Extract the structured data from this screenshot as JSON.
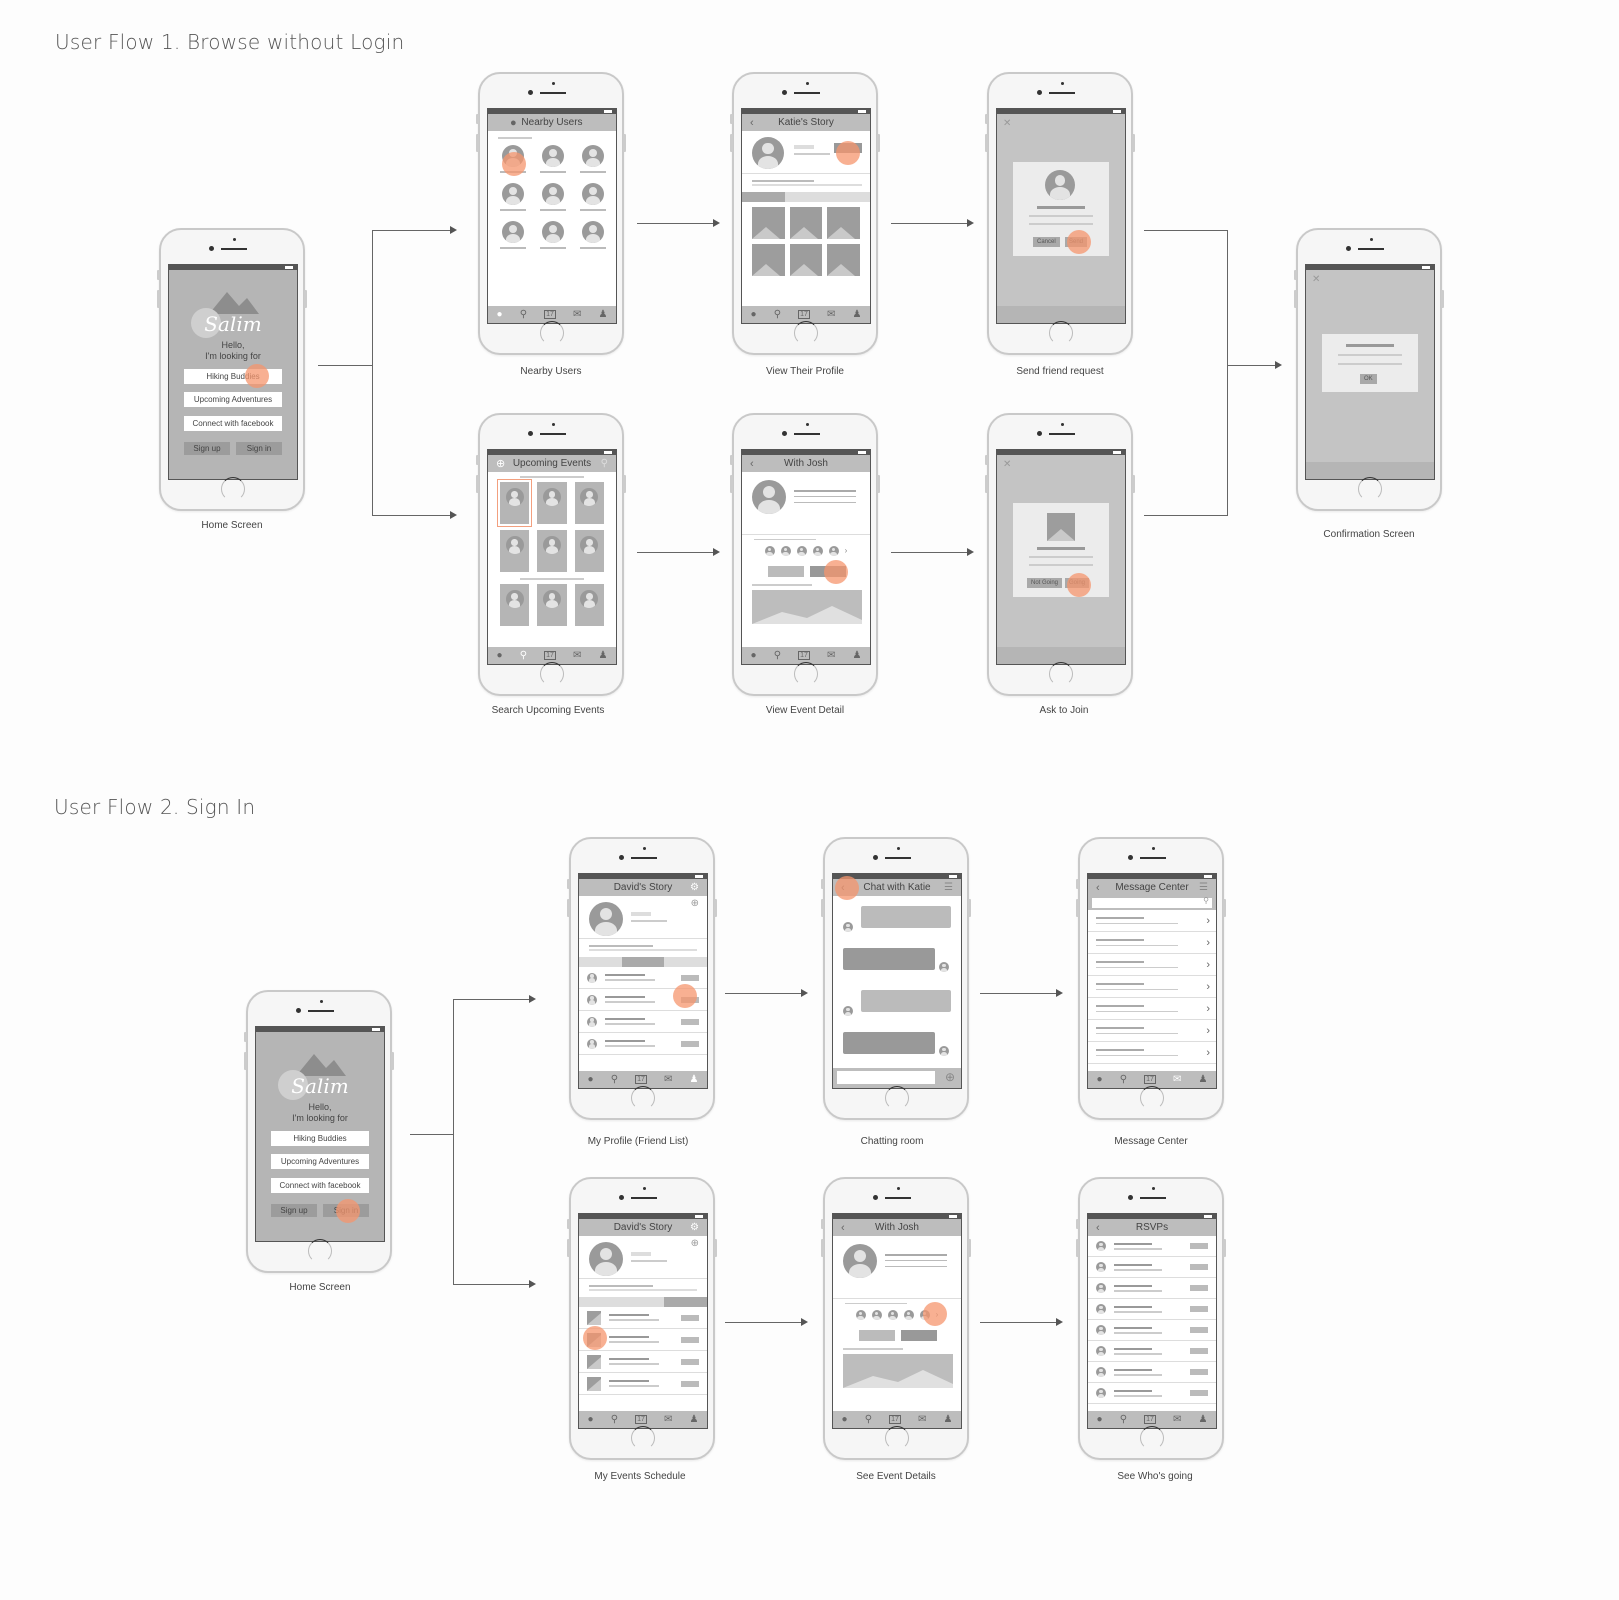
{
  "flow1": {
    "title": "User Flow 1. Browse without Login",
    "screens": {
      "home": {
        "caption": "Home Screen",
        "logo": "Salim",
        "greeting_line1": "Hello,",
        "greeting_line2": "I'm looking for",
        "options": [
          "Hiking Buddies",
          "Upcoming Adventures",
          "Connect with facebook"
        ],
        "sign_up": "Sign up",
        "sign_in": "Sign in",
        "tapped": "Hiking Buddies"
      },
      "nearby": {
        "caption": "Nearby Users",
        "title": "Nearby Users"
      },
      "profile": {
        "caption": "View Their Profile",
        "title": "Katie's Story"
      },
      "friend_request": {
        "caption": "Send friend request",
        "cancel": "Cancel",
        "send": "Send"
      },
      "events": {
        "caption": "Search Upcoming Events",
        "title": "Upcoming Events"
      },
      "event_detail": {
        "caption": "View Event Detail",
        "title": "With Josh"
      },
      "ask_join": {
        "caption": "Ask to Join",
        "not_going": "Not Going",
        "going": "Going"
      },
      "confirmation": {
        "caption": "Confirmation Screen",
        "ok": "OK"
      }
    }
  },
  "flow2": {
    "title": "User Flow 2. Sign In",
    "screens": {
      "home": {
        "caption": "Home Screen",
        "logo": "Salim",
        "greeting_line1": "Hello,",
        "greeting_line2": "I'm looking for",
        "options": [
          "Hiking Buddies",
          "Upcoming Adventures",
          "Connect with facebook"
        ],
        "sign_up": "Sign up",
        "sign_in": "Sign in",
        "tapped": "Sign in"
      },
      "my_profile": {
        "caption": "My Profile (Friend List)",
        "title": "David's Story"
      },
      "chat": {
        "caption": "Chatting room",
        "title": "Chat with Katie"
      },
      "message_center": {
        "caption": "Message Center",
        "title": "Message Center"
      },
      "my_events": {
        "caption": "My Events Schedule",
        "title": "David's Story"
      },
      "event_details": {
        "caption": "See Event Details",
        "title": "With Josh"
      },
      "rsvps": {
        "caption": "See Who's going",
        "title": "RSVPs"
      }
    }
  },
  "tabbar_icons": [
    "location-pin-icon",
    "search-icon",
    "calendar-icon",
    "mail-icon",
    "user-icon"
  ],
  "calendar_day": "17",
  "colors": {
    "tap_highlight": "#f6966e",
    "wire_gray": "#bdbdbd",
    "dark_gray": "#9a9a9a"
  }
}
